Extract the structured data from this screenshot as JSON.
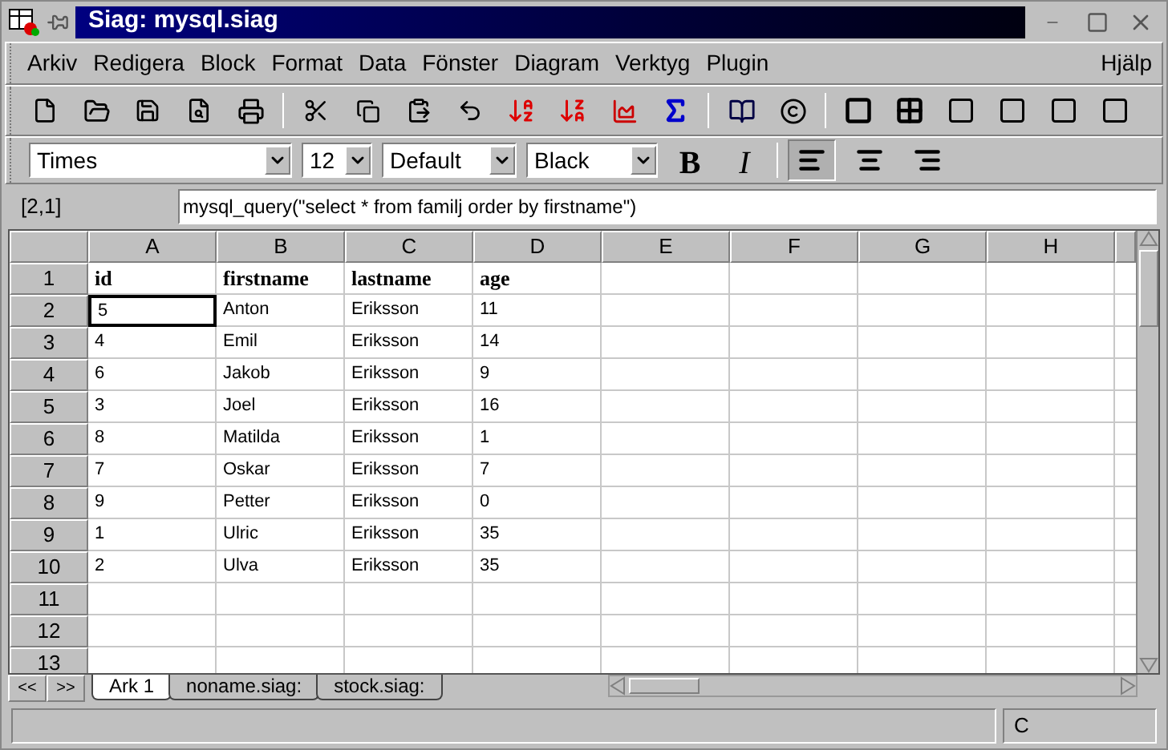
{
  "window": {
    "title": "Siag: mysql.siag"
  },
  "menu": [
    "Arkiv",
    "Redigera",
    "Block",
    "Format",
    "Data",
    "Fönster",
    "Diagram",
    "Verktyg",
    "Plugin"
  ],
  "help_menu": "Hjälp",
  "format_bar": {
    "font": "Times",
    "size": "12",
    "style": "Default",
    "text_colour_name": "Black",
    "bold_label": "B",
    "italic_label": "I",
    "alignment": [
      {
        "kind": "left",
        "selected": true
      },
      {
        "kind": "center",
        "selected": false
      },
      {
        "kind": "right",
        "selected": false
      }
    ]
  },
  "formula_bar": {
    "cell_ref": "[2,1]",
    "formula": "mysql_query(\"select * from familj order by firstname\")"
  },
  "sheet": {
    "columns": [
      "A",
      "B",
      "C",
      "D",
      "E",
      "F",
      "G",
      "H"
    ],
    "rows": [
      {
        "label": "1",
        "kind": "header",
        "cells": [
          {
            "text": "id",
            "selected": false
          },
          {
            "text": "firstname",
            "selected": false
          },
          {
            "text": "lastname",
            "selected": false
          },
          {
            "text": "age",
            "selected": false
          }
        ]
      },
      {
        "label": "2",
        "kind": "data",
        "cells": [
          {
            "text": "5",
            "selected": true
          },
          {
            "text": "Anton",
            "selected": false
          },
          {
            "text": "Eriksson",
            "selected": false
          },
          {
            "text": "11",
            "selected": false
          }
        ]
      },
      {
        "label": "3",
        "kind": "data",
        "cells": [
          {
            "text": "4",
            "selected": false
          },
          {
            "text": "Emil",
            "selected": false
          },
          {
            "text": "Eriksson",
            "selected": false
          },
          {
            "text": "14",
            "selected": false
          }
        ]
      },
      {
        "label": "4",
        "kind": "data",
        "cells": [
          {
            "text": "6",
            "selected": false
          },
          {
            "text": "Jakob",
            "selected": false
          },
          {
            "text": "Eriksson",
            "selected": false
          },
          {
            "text": "9",
            "selected": false
          }
        ]
      },
      {
        "label": "5",
        "kind": "data",
        "cells": [
          {
            "text": "3",
            "selected": false
          },
          {
            "text": "Joel",
            "selected": false
          },
          {
            "text": "Eriksson",
            "selected": false
          },
          {
            "text": "16",
            "selected": false
          }
        ]
      },
      {
        "label": "6",
        "kind": "data",
        "cells": [
          {
            "text": "8",
            "selected": false
          },
          {
            "text": "Matilda",
            "selected": false
          },
          {
            "text": "Eriksson",
            "selected": false
          },
          {
            "text": "1",
            "selected": false
          }
        ]
      },
      {
        "label": "7",
        "kind": "data",
        "cells": [
          {
            "text": "7",
            "selected": false
          },
          {
            "text": "Oskar",
            "selected": false
          },
          {
            "text": "Eriksson",
            "selected": false
          },
          {
            "text": "7",
            "selected": false
          }
        ]
      },
      {
        "label": "8",
        "kind": "data",
        "cells": [
          {
            "text": "9",
            "selected": false
          },
          {
            "text": "Petter",
            "selected": false
          },
          {
            "text": "Eriksson",
            "selected": false
          },
          {
            "text": "0",
            "selected": false
          }
        ]
      },
      {
        "label": "9",
        "kind": "data",
        "cells": [
          {
            "text": "1",
            "selected": false
          },
          {
            "text": "Ulric",
            "selected": false
          },
          {
            "text": "Eriksson",
            "selected": false
          },
          {
            "text": "35",
            "selected": false
          }
        ]
      },
      {
        "label": "10",
        "kind": "data",
        "cells": [
          {
            "text": "2",
            "selected": false
          },
          {
            "text": "Ulva",
            "selected": false
          },
          {
            "text": "Eriksson",
            "selected": false
          },
          {
            "text": "35",
            "selected": false
          }
        ]
      },
      {
        "label": "11",
        "kind": "data",
        "cells": []
      },
      {
        "label": "12",
        "kind": "data",
        "cells": []
      },
      {
        "label": "13",
        "kind": "data",
        "cells": []
      }
    ]
  },
  "sheet_nav": [
    "<<",
    ">>"
  ],
  "sheet_tabs": [
    {
      "label": "Ark 1",
      "selected": true
    },
    {
      "label": "noname.siag:",
      "selected": false
    },
    {
      "label": "stock.siag:",
      "selected": false
    }
  ],
  "status_bar": {
    "mode": "C"
  }
}
